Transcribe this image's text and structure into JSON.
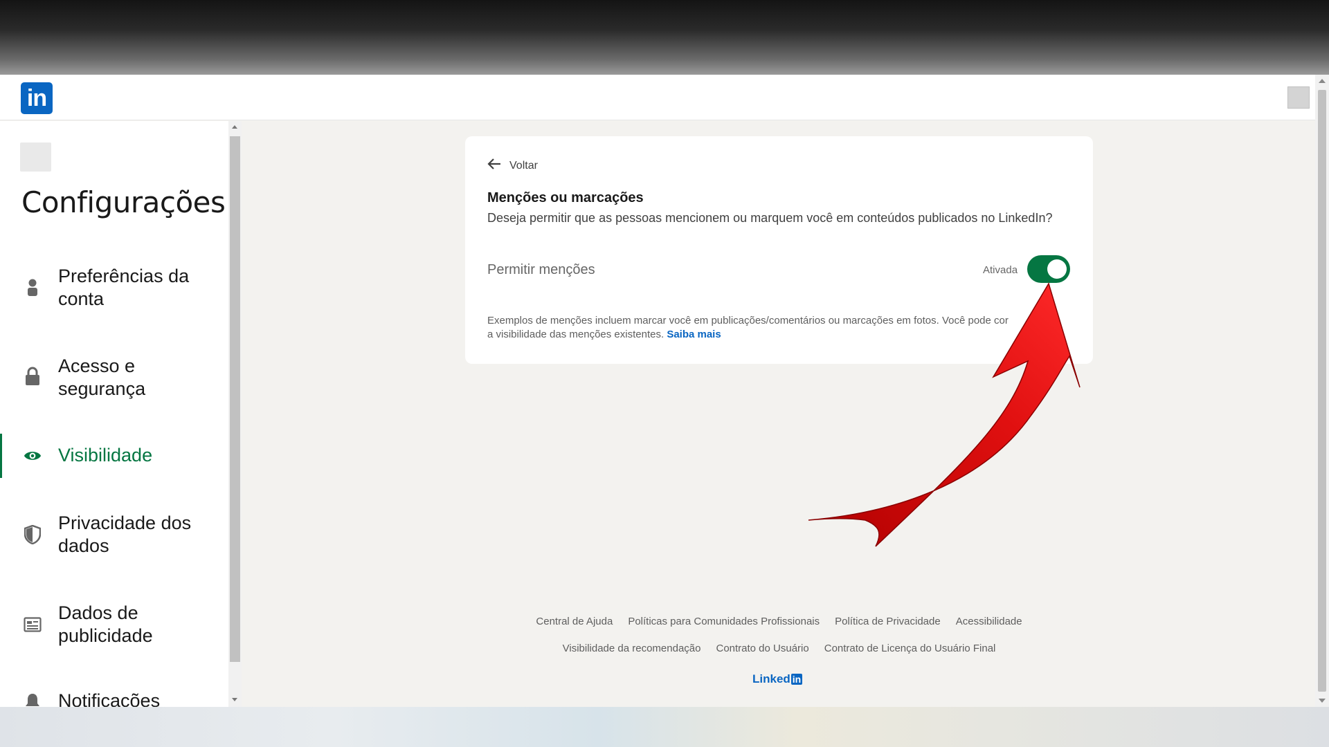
{
  "header": {
    "logo_text": "in"
  },
  "sidebar": {
    "title": "Configurações",
    "items": [
      {
        "label": "Preferências da conta",
        "icon": "person-icon"
      },
      {
        "label": "Acesso e segurança",
        "icon": "lock-icon"
      },
      {
        "label": "Visibilidade",
        "icon": "eye-icon",
        "active": true
      },
      {
        "label": "Privacidade dos dados",
        "icon": "shield-icon"
      },
      {
        "label": "Dados de publicidade",
        "icon": "ad-data-icon"
      },
      {
        "label": "Notificações",
        "icon": "bell-icon"
      }
    ]
  },
  "card": {
    "back_label": "Voltar",
    "title": "Menções ou marcações",
    "description": "Deseja permitir que as pessoas mencionem ou marquem você em conteúdos publicados no LinkedIn?",
    "toggle_label": "Permitir menções",
    "toggle_state": "Ativada",
    "toggle_on": true,
    "note_line1": "Exemplos de menções incluem marcar você em publicações/comentários ou marcações em fotos. Você pode co",
    "note_line1_tail": "r",
    "note_line2": "a visibilidade das menções existentes.",
    "note_link": "Saiba mais"
  },
  "footer": {
    "row1": [
      "Central de Ajuda",
      "Políticas para Comunidades Profissionais",
      "Política de Privacidade",
      "Acessibilidade"
    ],
    "row2": [
      "Visibilidade da recomendação",
      "Contrato do Usuário",
      "Contrato de Licença do Usuário Final"
    ],
    "brand_text": "Linked",
    "brand_box": "in"
  },
  "colors": {
    "accent_green": "#057642",
    "brand_blue": "#0a66c2",
    "annotation_red": "#d50b0b"
  }
}
